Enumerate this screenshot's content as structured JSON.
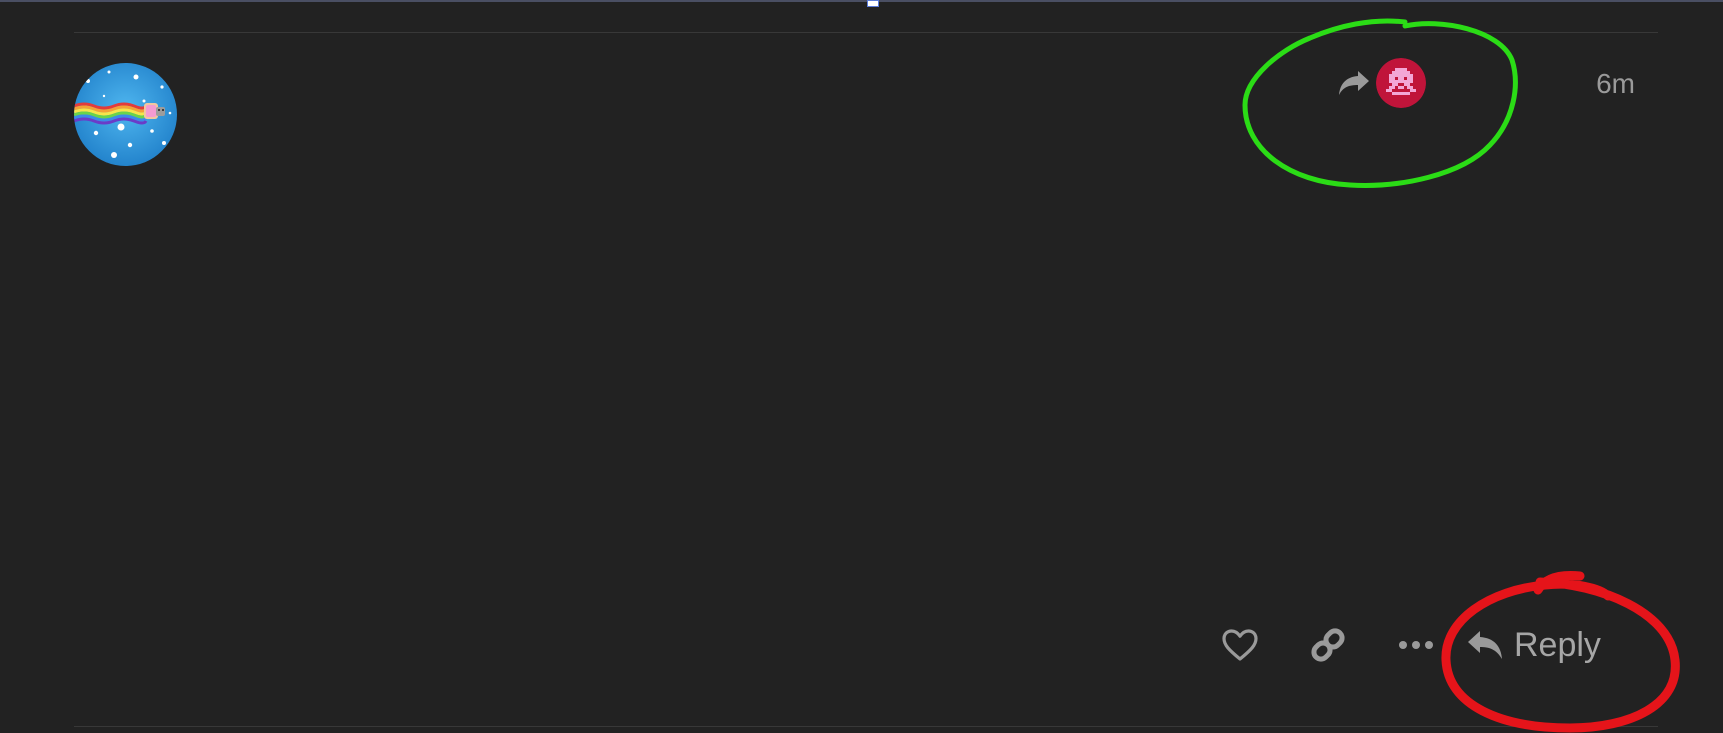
{
  "post": {
    "avatar_icon": "nyan-cat-avatar-icon",
    "reply_to": {
      "share_icon": "share-arrow-icon",
      "avatar_icon": "space-invader-avatar-icon"
    },
    "date": "6m"
  },
  "actions": {
    "like_icon": "heart-icon",
    "link_icon": "link-icon",
    "more_icon": "ellipsis-icon",
    "reply_icon": "reply-arrow-icon",
    "reply_label": "Reply"
  },
  "annotations": {
    "green_circle_color": "#2bdc16",
    "red_circle_color": "#e5141a"
  },
  "colors": {
    "background": "#222222",
    "muted_text": "#9a9a9a"
  }
}
